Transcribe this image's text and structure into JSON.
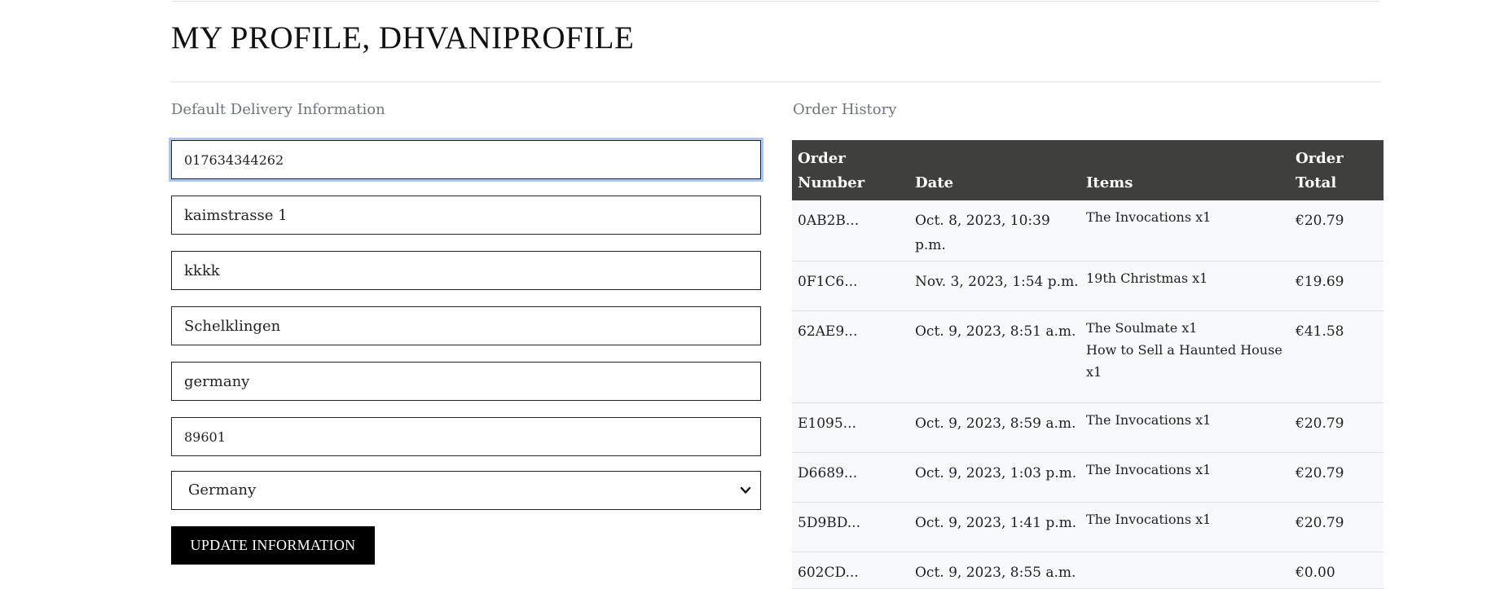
{
  "page": {
    "title": "MY PROFILE, DHVANIPROFILE"
  },
  "delivery": {
    "heading": "Default Delivery Information",
    "phone": "017634344262",
    "street_address1": "kaimstrasse 1",
    "street_address2": "kkkk",
    "town_or_city": "Schelklingen",
    "county": "germany",
    "postcode": "89601",
    "country_selected": "Germany",
    "update_button": "UPDATE INFORMATION"
  },
  "orders": {
    "heading": "Order History",
    "columns": [
      [
        "Order",
        "Number"
      ],
      [
        "Date"
      ],
      [
        "Items"
      ],
      [
        "Order",
        "Total"
      ]
    ],
    "rows": [
      {
        "number": "0AB2B...",
        "date": "Oct. 8, 2023, 10:39 p.m.",
        "items": [
          "The Invocations x1"
        ],
        "total": "€20.79"
      },
      {
        "number": "0F1C6...",
        "date": "Nov. 3, 2023, 1:54 p.m.",
        "items": [
          "19th Christmas x1"
        ],
        "total": "€19.69"
      },
      {
        "number": "62AE9...",
        "date": "Oct. 9, 2023, 8:51 a.m.",
        "items": [
          "The Soulmate x1",
          "How to Sell a Haunted House x1"
        ],
        "total": "€41.58"
      },
      {
        "number": "E1095...",
        "date": "Oct. 9, 2023, 8:59 a.m.",
        "items": [
          "The Invocations x1"
        ],
        "total": "€20.79"
      },
      {
        "number": "D6689...",
        "date": "Oct. 9, 2023, 1:03 p.m.",
        "items": [
          "The Invocations x1"
        ],
        "total": "€20.79"
      },
      {
        "number": "5D9BD...",
        "date": "Oct. 9, 2023, 1:41 p.m.",
        "items": [
          "The Invocations x1"
        ],
        "total": "€20.79"
      },
      {
        "number": "602CD...",
        "date": "Oct. 9, 2023, 8:55 a.m.",
        "items": [],
        "total": "€0.00"
      }
    ]
  },
  "colors": {
    "table_header": "#3f3f3d",
    "row_bg": "#f8f9fa",
    "button": "#000000",
    "focus_ring": "#a9c6f5",
    "muted_heading": "#6c757d"
  },
  "icons": {
    "select_chevron": "chevron-down-icon"
  }
}
